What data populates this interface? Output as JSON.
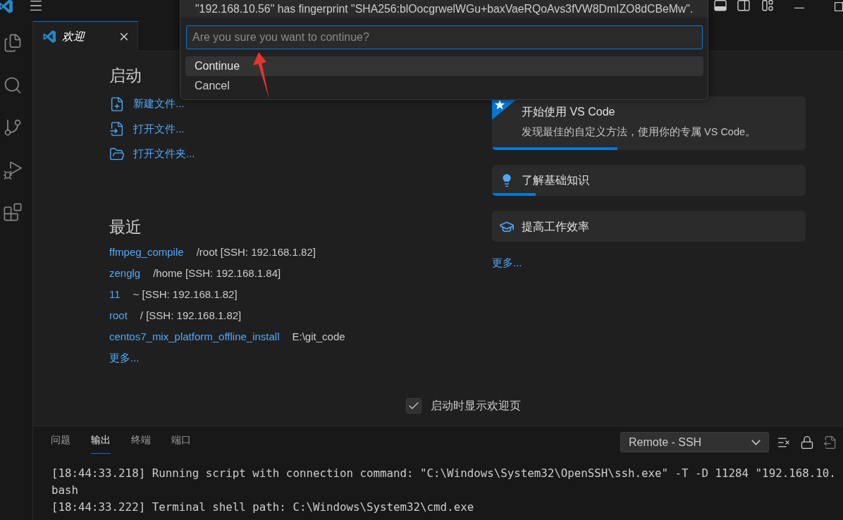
{
  "quick_pick": {
    "message": "\"192.168.10.56\" has fingerprint \"SHA256:blOocgrwelWGu+baxVaeRQoAvs3fVW8DmIZO8dCBeMw\".",
    "input": {
      "placeholder": "Are you sure you want to continue?"
    },
    "items": [
      {
        "label": "Continue",
        "selected": true
      },
      {
        "label": "Cancel",
        "selected": false
      }
    ]
  },
  "tabs": [
    {
      "label": "欢迎",
      "selected": true
    }
  ],
  "welcome": {
    "start": {
      "title": "启动",
      "items": [
        {
          "kind": "new_file",
          "label": "新建文件..."
        },
        {
          "kind": "open_file",
          "label": "打开文件..."
        },
        {
          "kind": "open_folder",
          "label": "打开文件夹..."
        }
      ]
    },
    "recent": {
      "title": "最近",
      "items": [
        {
          "name": "ffmpeg_compile",
          "path": "/root [SSH: 192.168.1.82]"
        },
        {
          "name": "zenglg",
          "path": "/home [SSH: 192.168.1.84]"
        },
        {
          "name": "11",
          "path": "~ [SSH: 192.168.1.82]"
        },
        {
          "name": "root",
          "path": "/ [SSH: 192.168.1.82]"
        },
        {
          "name": "centos7_mix_platform_offline_install",
          "path": "E:\\git_code"
        }
      ],
      "more": "更多..."
    },
    "walkthroughs": {
      "items": [
        {
          "kind": "featured",
          "title": "开始使用 VS Code",
          "description": "发现最佳的自定义方法，使用你的专属 VS Code。",
          "level": 0.4
        },
        {
          "kind": "bulb",
          "title": "了解基础知识",
          "level": 0.14
        },
        {
          "kind": "cap",
          "title": "提高工作效率"
        }
      ],
      "more": "更多..."
    },
    "show_on_startup": {
      "label": "启动时显示欢迎页",
      "checked": true
    }
  },
  "panel": {
    "tabs": [
      {
        "label": "问题",
        "selected": false
      },
      {
        "label": "输出",
        "selected": true
      },
      {
        "label": "终端",
        "selected": false
      },
      {
        "label": "端口",
        "selected": false
      }
    ],
    "channel": {
      "value": "Remote - SSH"
    },
    "output_lines": [
      "[18:44:33.218] Running script with connection command: \"C:\\Windows\\System32\\OpenSSH\\ssh.exe\" -T -D 11284 \"192.168.10.",
      "bash",
      "[18:44:33.222] Terminal shell path: C:\\Windows\\System32\\cmd.exe"
    ]
  }
}
